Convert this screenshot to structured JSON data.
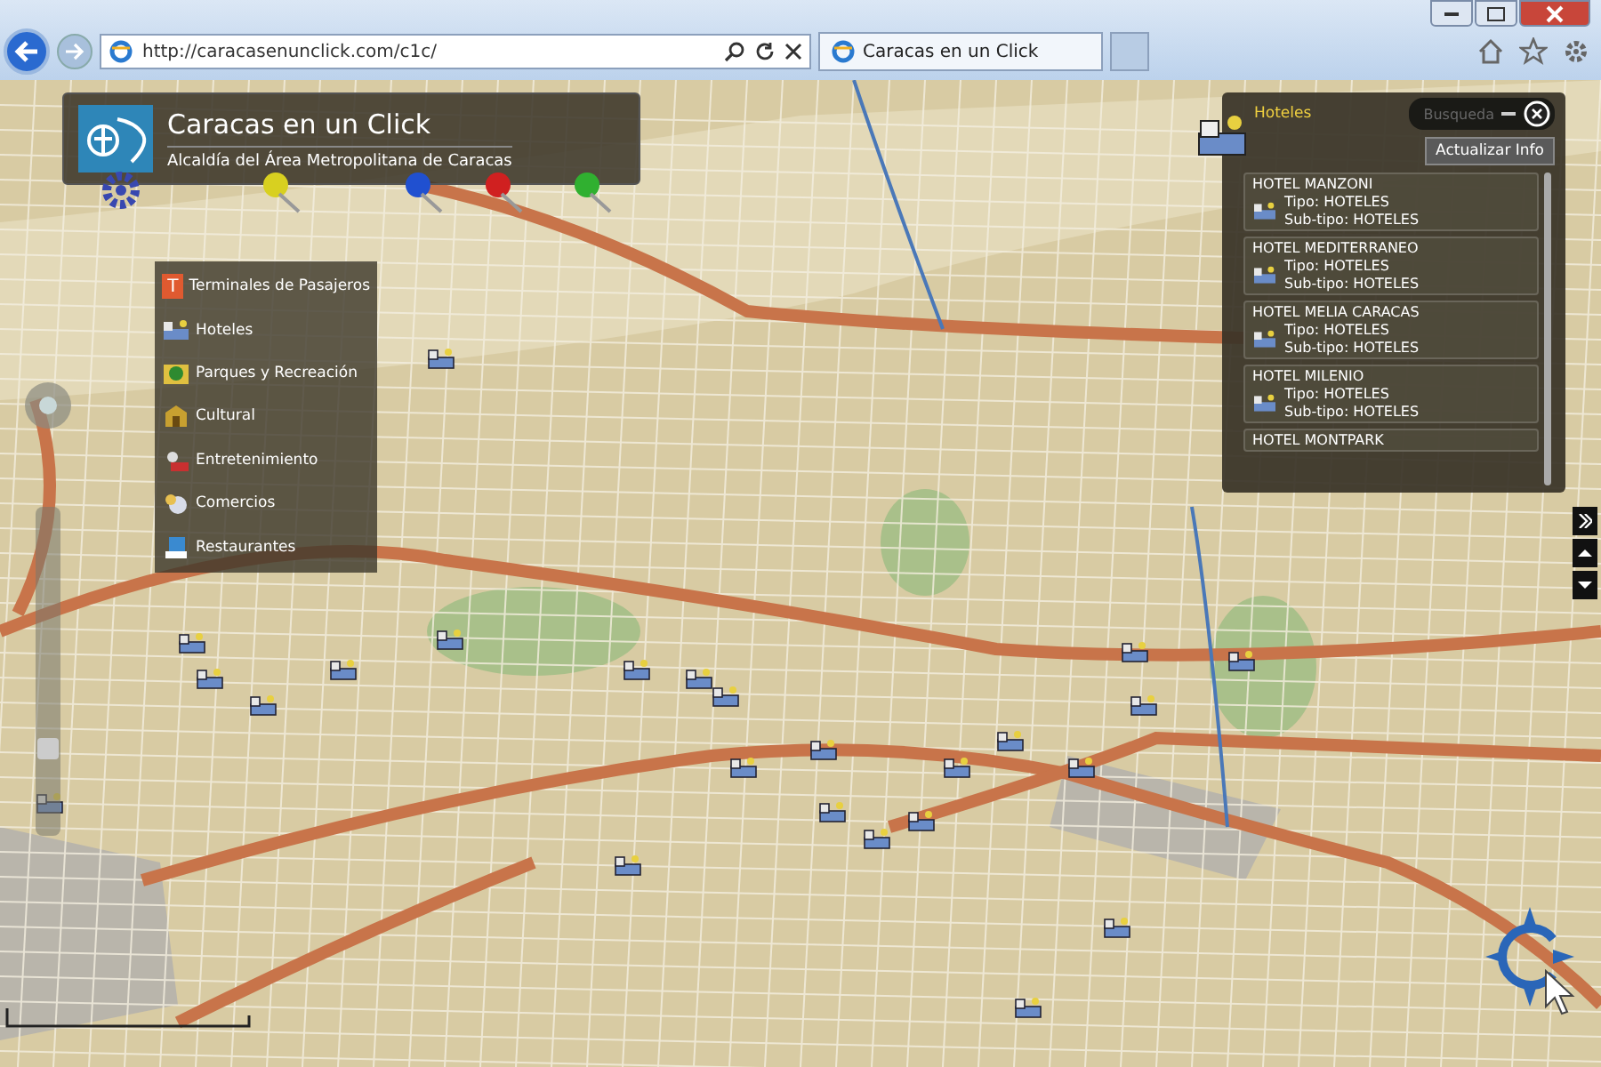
{
  "browser": {
    "url": "http://caracasenunclick.com/c1c/",
    "tabs": [
      {
        "title": "Caracas en un Click",
        "selected": true
      }
    ]
  },
  "header": {
    "title": "Caracas en un Click",
    "subtitle": "Alcaldía del Área Metropolitana de Caracas"
  },
  "zoom": {
    "level": 0.25
  },
  "pins": [
    {
      "color": "#d8d020"
    },
    {
      "color": "#2050d0"
    },
    {
      "color": "#d02020"
    },
    {
      "color": "#30b030"
    }
  ],
  "categories": [
    {
      "kind": "terminal",
      "label": "Terminales de Pasajeros",
      "icon_letter": "T"
    },
    {
      "kind": "hotel",
      "label": "Hoteles"
    },
    {
      "kind": "park",
      "label": "Parques y Recreación"
    },
    {
      "kind": "culture",
      "label": "Cultural"
    },
    {
      "kind": "entertainment",
      "label": "Entretenimiento"
    },
    {
      "kind": "shopping",
      "label": "Comercios"
    },
    {
      "kind": "restaurant",
      "label": "Restaurantes"
    }
  ],
  "hotels_panel": {
    "title": "Hoteles",
    "search_label": "Busqueda",
    "update_button": "Actualizar Info",
    "items": [
      {
        "name": "HOTEL MANZONI",
        "type": "Tipo: HOTELES",
        "subtype": "Sub-tipo: HOTELES"
      },
      {
        "name": "HOTEL MEDITERRANEO",
        "type": "Tipo: HOTELES",
        "subtype": "Sub-tipo: HOTELES"
      },
      {
        "name": "HOTEL MELIA CARACAS",
        "type": "Tipo: HOTELES",
        "subtype": "Sub-tipo: HOTELES"
      },
      {
        "name": "HOTEL MILENIO",
        "type": "Tipo: HOTELES",
        "subtype": "Sub-tipo: HOTELES"
      },
      {
        "name": "HOTEL MONTPARK"
      }
    ]
  }
}
